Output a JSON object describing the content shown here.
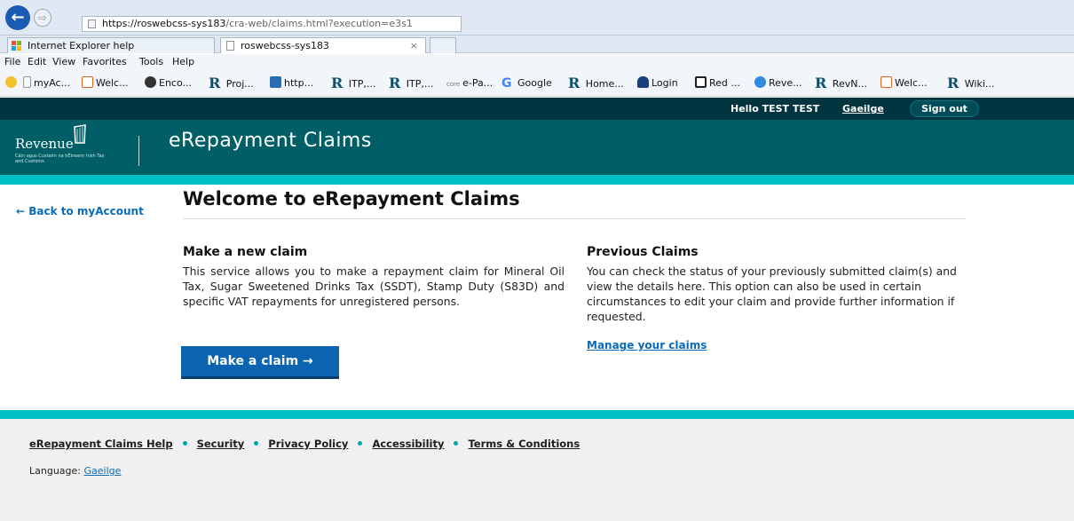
{
  "browser": {
    "url_host": "https://roswebcss-sys183",
    "url_path": "/cra-web/claims.html?execution=e3s1",
    "tabs": [
      {
        "label": "Internet Explorer help"
      },
      {
        "label": "roswebcss-sys183"
      }
    ],
    "tab_close": "×",
    "menu": [
      "File",
      "Edit",
      "View",
      "Favorites",
      "Tools",
      "Help"
    ],
    "favorites": [
      {
        "label": "myAc...",
        "icon": "page-icon"
      },
      {
        "label": "Welc...",
        "icon": "s-icon"
      },
      {
        "label": "Enco...",
        "icon": "play-icon"
      },
      {
        "label": "Proj...",
        "icon": "revenue-r-icon"
      },
      {
        "label": "http...",
        "icon": "chart-icon"
      },
      {
        "label": "ITP,...",
        "icon": "revenue-r-icon"
      },
      {
        "label": "ITP,...",
        "icon": "revenue-r-icon"
      },
      {
        "label": "e-Pa...",
        "icon": "core-icon",
        "badge": "core"
      },
      {
        "label": "Google",
        "icon": "google-g-icon"
      },
      {
        "label": "Home...",
        "icon": "revenue-r-icon"
      },
      {
        "label": "Login",
        "icon": "shield-icon"
      },
      {
        "label": "Red ...",
        "icon": "frame-icon"
      },
      {
        "label": "Reve...",
        "icon": "ie-icon"
      },
      {
        "label": "RevN...",
        "icon": "revenue-r-icon"
      },
      {
        "label": "Welc...",
        "icon": "s-icon"
      },
      {
        "label": "Wiki...",
        "icon": "revenue-r-icon"
      }
    ],
    "back_glyph": "←",
    "forward_glyph": "⇨",
    "r_glyph": "R",
    "g_glyph": "G"
  },
  "header": {
    "greeting": "Hello TEST TEST",
    "language_link": "Gaeilge",
    "sign_out": "Sign out",
    "logo_word": "Revenue",
    "logo_sub": "Cáin agus Custaim na hÉireann Irish Tax and Customs",
    "app_title": "eRepayment Claims"
  },
  "main": {
    "back_link": "← Back to myAccount",
    "title": "Welcome to eRepayment Claims",
    "new_claim": {
      "heading": "Make a new claim",
      "body": "This service allows you to make a repayment claim for Mineral Oil Tax, Sugar Sweetened Drinks Tax (SSDT), Stamp Duty (S83D) and specific VAT repayments for unregistered persons.",
      "button": "Make a claim →"
    },
    "previous": {
      "heading": "Previous Claims",
      "body": "You can check the status of your previously submitted claim(s) and view the details here. This option can also be used in certain circumstances to edit your claim and provide further information if requested.",
      "link": "Manage your claims"
    }
  },
  "footer": {
    "links": [
      "eRepayment Claims Help",
      "Security",
      "Privacy Policy",
      "Accessibility",
      "Terms & Conditions"
    ],
    "language_label": "Language:",
    "language_link": "Gaeilge"
  },
  "colors": {
    "header_dark": "#00343f",
    "banner": "#005f66",
    "accent_teal": "#00c0c7",
    "button_blue": "#0c64b0",
    "link_blue": "#0a6cb8"
  }
}
